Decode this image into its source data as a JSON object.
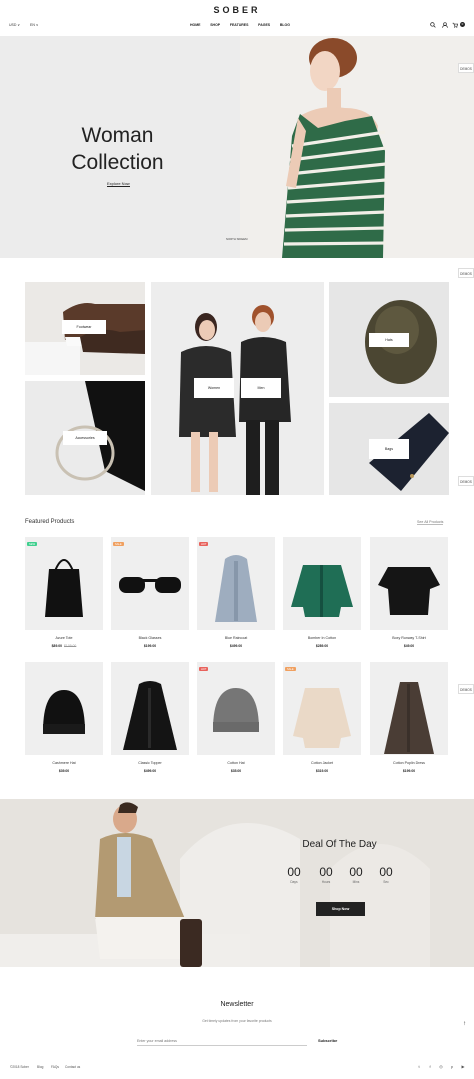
{
  "header": {
    "logo": "SOBER",
    "language": "USD ∨",
    "currency": "EN ∨",
    "nav": [
      "HOME",
      "SHOP",
      "FEATURES",
      "PAGES",
      "BLOG"
    ],
    "cart_count": "0",
    "demos_label": "DEMOS"
  },
  "hero": {
    "title_line1": "Woman",
    "title_line2": "Collection",
    "cta": "Explore Now",
    "caption": "NORTH SIDEEM"
  },
  "categories": [
    "Footwear",
    "Women",
    "Men",
    "Hats",
    "Accessories",
    "Bags"
  ],
  "featured": {
    "title": "Featured Products",
    "see_all": "See All Products",
    "products": [
      {
        "name": "Azure Tote",
        "price": "$89.00",
        "old_price": "$109.00",
        "badge": "NEW",
        "badge_color": "#3fcf8e"
      },
      {
        "name": "Black Glasses",
        "price": "$199.00",
        "old_price": "",
        "badge": "SALE",
        "badge_color": "#f0a060"
      },
      {
        "name": "Blue Raincoat",
        "price": "$499.00",
        "old_price": "",
        "badge": "HOT",
        "badge_color": "#e8625c"
      },
      {
        "name": "Bomber In Cotton",
        "price": "$289.00",
        "old_price": "",
        "badge": "",
        "badge_color": ""
      },
      {
        "name": "Boxy Runway T-Shirt",
        "price": "$49.00",
        "old_price": "",
        "badge": "",
        "badge_color": ""
      },
      {
        "name": "Cashmere Hat",
        "price": "$39.00",
        "old_price": "",
        "badge": "",
        "badge_color": ""
      },
      {
        "name": "Classic Topper",
        "price": "$499.00",
        "old_price": "",
        "badge": "",
        "badge_color": ""
      },
      {
        "name": "Cotton Hat",
        "price": "$35.00",
        "old_price": "",
        "badge": "HOT",
        "badge_color": "#e8625c"
      },
      {
        "name": "Cotton Jacket",
        "price": "$319.00",
        "old_price": "",
        "badge": "SALE",
        "badge_color": "#f0a060"
      },
      {
        "name": "Cotton Poplin Dress",
        "price": "$199.00",
        "old_price": "",
        "badge": "",
        "badge_color": ""
      }
    ]
  },
  "deal": {
    "title": "Deal Of The Day",
    "countdown": [
      {
        "value": "00",
        "label": "Days"
      },
      {
        "value": "00",
        "label": "Hours"
      },
      {
        "value": "00",
        "label": "Mins"
      },
      {
        "value": "00",
        "label": "Sec"
      }
    ],
    "cta": "Shop Now"
  },
  "newsletter": {
    "title": "Newsletter",
    "subtitle": "Get timely updates from your favorite products",
    "placeholder": "Enter your email address",
    "button": "Subscribe"
  },
  "footer": {
    "links": [
      "©2018 Sober",
      "Blog",
      "FAQs",
      "Contact us"
    ],
    "social": [
      "twitter-icon",
      "facebook-icon",
      "instagram-icon",
      "pinterest-icon",
      "youtube-icon"
    ]
  }
}
